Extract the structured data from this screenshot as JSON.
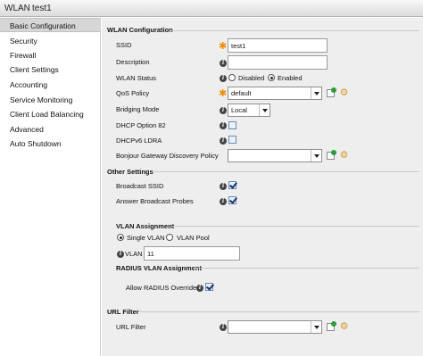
{
  "title": {
    "wlan": "WLAN",
    "name": "test1"
  },
  "sidebar": {
    "items": [
      {
        "label": "Basic Configuration"
      },
      {
        "label": "Security"
      },
      {
        "label": "Firewall"
      },
      {
        "label": "Client Settings"
      },
      {
        "label": "Accounting"
      },
      {
        "label": "Service Monitoring"
      },
      {
        "label": "Client Load Balancing"
      },
      {
        "label": "Advanced"
      },
      {
        "label": "Auto Shutdown"
      }
    ],
    "active": "Basic Configuration"
  },
  "wlan_config": {
    "heading": "WLAN Configuration",
    "ssid_label": "SSID",
    "ssid_value": "test1",
    "description_label": "Description",
    "description_value": "",
    "status_label": "WLAN Status",
    "status_disabled": "Disabled",
    "status_enabled": "Enabled",
    "status_selected": "Enabled",
    "qos_label": "QoS Policy",
    "qos_value": "default",
    "bridging_label": "Bridging Mode",
    "bridging_value": "Local",
    "dhcp82_label": "DHCP Option 82",
    "dhcp82_checked": false,
    "dhcpv6_label": "DHCPv6 LDRA",
    "dhcpv6_checked": false,
    "bonjour_label": "Bonjour Gateway Discovery Policy",
    "bonjour_value": ""
  },
  "other_settings": {
    "heading": "Other Settings",
    "broadcast_label": "Broadcast SSID",
    "broadcast_checked": true,
    "answer_label": "Answer Broadcast Probes",
    "answer_checked": true
  },
  "vlan_assignment": {
    "heading": "VLAN Assignment",
    "single_label": "Single VLAN",
    "pool_label": "VLAN Pool",
    "selected": "Single VLAN",
    "vlan_label": "VLAN",
    "vlan_value": "11"
  },
  "radius_vlan": {
    "heading": "RADIUS VLAN Assignment",
    "allow_label": "Allow RADIUS Override",
    "allow_checked": true
  },
  "url_filter": {
    "heading": "URL Filter",
    "label": "URL Filter",
    "value": ""
  },
  "colors": {
    "required_star": "#f08c00",
    "active_sidebar": "#d6d6d6",
    "panel_bg": "#eeeeee",
    "add_badge": "#2e9b3a",
    "gear": "#d49a2a"
  },
  "icons": [
    "info-icon",
    "required-star-icon",
    "new-policy-icon",
    "configure-gear-icon",
    "dropdown-arrow-icon"
  ]
}
